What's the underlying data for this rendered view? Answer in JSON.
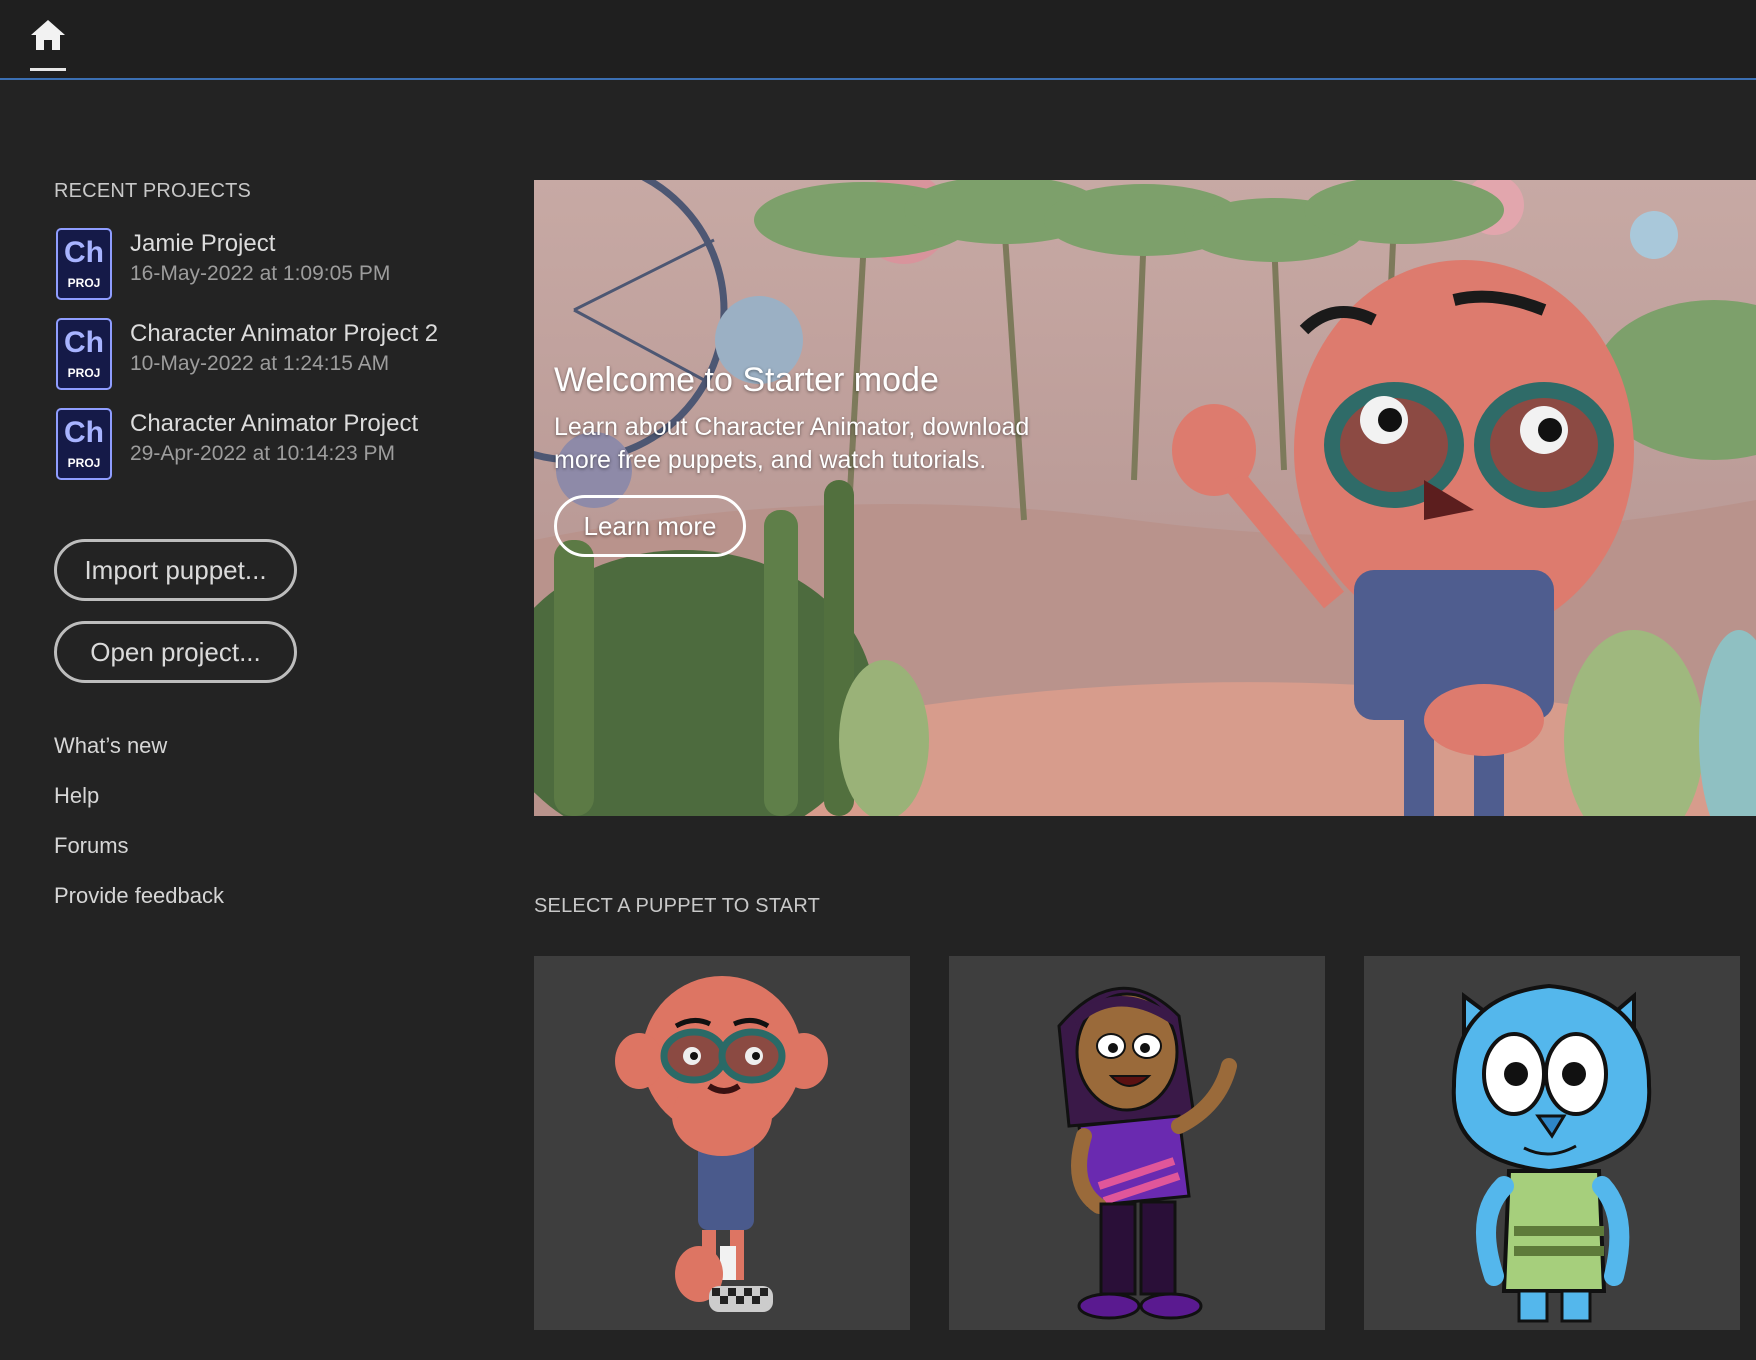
{
  "topbar": {
    "home_icon": "home-icon"
  },
  "recent": {
    "title": "RECENT PROJECTS",
    "icon_label_top": "Ch",
    "icon_label_bottom": "PROJ",
    "items": [
      {
        "name": "Jamie Project",
        "date": "16-May-2022 at 1:09:05 PM"
      },
      {
        "name": "Character Animator Project 2",
        "date": "10-May-2022 at 1:24:15 AM"
      },
      {
        "name": "Character Animator Project",
        "date": "29-Apr-2022 at 10:14:23 PM"
      }
    ]
  },
  "actions": {
    "import_label": "Import puppet...",
    "open_label": "Open project..."
  },
  "links": {
    "whats_new": "What’s new",
    "help": "Help",
    "forums": "Forums",
    "feedback": "Provide feedback"
  },
  "hero": {
    "title": "Welcome to Starter mode",
    "description": "Learn about Character Animator, download more free puppets, and watch tutorials.",
    "button_label": "Learn more"
  },
  "puppets": {
    "title": "SELECT A PUPPET TO START",
    "items": [
      {
        "name": "red-furry-puppet"
      },
      {
        "name": "girl-puppet"
      },
      {
        "name": "blue-cat-puppet"
      }
    ]
  },
  "colors": {
    "background": "#232323",
    "accent_line": "#3b6fb3",
    "ch_icon_bg": "#151a48",
    "ch_icon_border": "#8f9dff",
    "card_bg": "#3e3e3e"
  }
}
